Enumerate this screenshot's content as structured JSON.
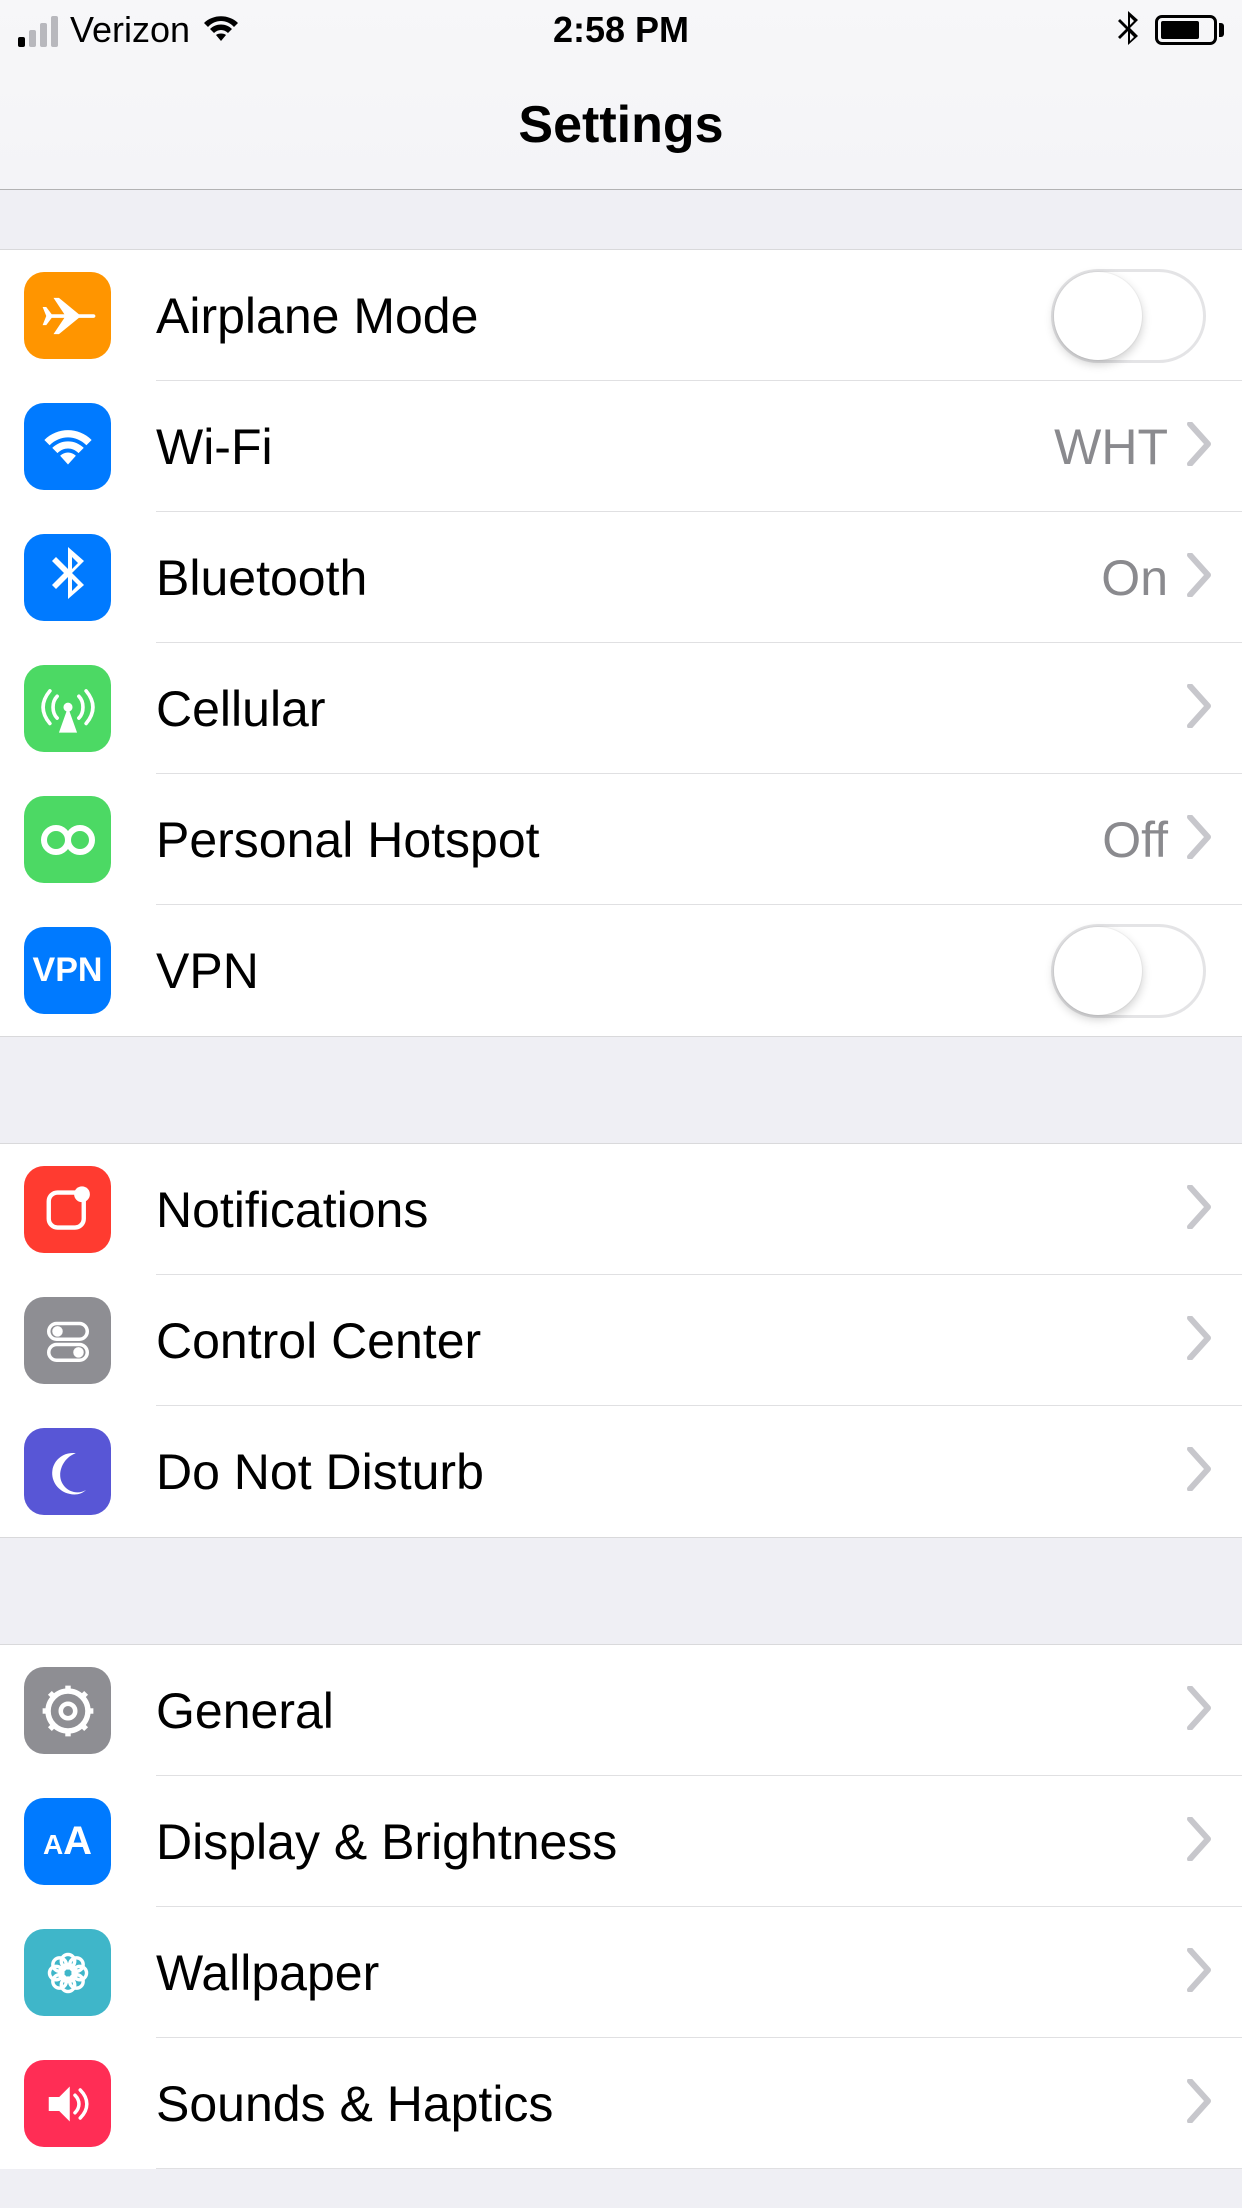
{
  "status": {
    "carrier": "Verizon",
    "time": "2:58 PM"
  },
  "nav": {
    "title": "Settings"
  },
  "groups": [
    {
      "rows": [
        {
          "id": "airplane",
          "label": "Airplane Mode",
          "icon": "airplane-icon",
          "color": "bg-orange",
          "type": "switch",
          "switch": false
        },
        {
          "id": "wifi",
          "label": "Wi-Fi",
          "detail": "WHT",
          "icon": "wifi-icon",
          "color": "bg-blue",
          "type": "link"
        },
        {
          "id": "bluetooth",
          "label": "Bluetooth",
          "detail": "On",
          "icon": "bluetooth-icon",
          "color": "bg-blue",
          "type": "link"
        },
        {
          "id": "cellular",
          "label": "Cellular",
          "icon": "cellular-icon",
          "color": "bg-green",
          "type": "link"
        },
        {
          "id": "hotspot",
          "label": "Personal Hotspot",
          "detail": "Off",
          "icon": "hotspot-icon",
          "color": "bg-green",
          "type": "link"
        },
        {
          "id": "vpn",
          "label": "VPN",
          "icon": "vpn-icon",
          "color": "bg-blue",
          "type": "switch",
          "switch": false
        }
      ]
    },
    {
      "rows": [
        {
          "id": "notifications",
          "label": "Notifications",
          "icon": "notifications-icon",
          "color": "bg-red",
          "type": "link"
        },
        {
          "id": "controlcenter",
          "label": "Control Center",
          "icon": "controlcenter-icon",
          "color": "bg-gray",
          "type": "link"
        },
        {
          "id": "dnd",
          "label": "Do Not Disturb",
          "icon": "moon-icon",
          "color": "bg-indigo",
          "type": "link"
        }
      ]
    },
    {
      "rows": [
        {
          "id": "general",
          "label": "General",
          "icon": "gear-icon",
          "color": "bg-gray",
          "type": "link"
        },
        {
          "id": "display",
          "label": "Display & Brightness",
          "icon": "display-icon",
          "color": "bg-blue",
          "type": "link"
        },
        {
          "id": "wallpaper",
          "label": "Wallpaper",
          "icon": "wallpaper-icon",
          "color": "bg-cyan",
          "type": "link"
        },
        {
          "id": "sounds",
          "label": "Sounds & Haptics",
          "icon": "sounds-icon",
          "color": "bg-pink",
          "type": "link"
        }
      ]
    }
  ]
}
